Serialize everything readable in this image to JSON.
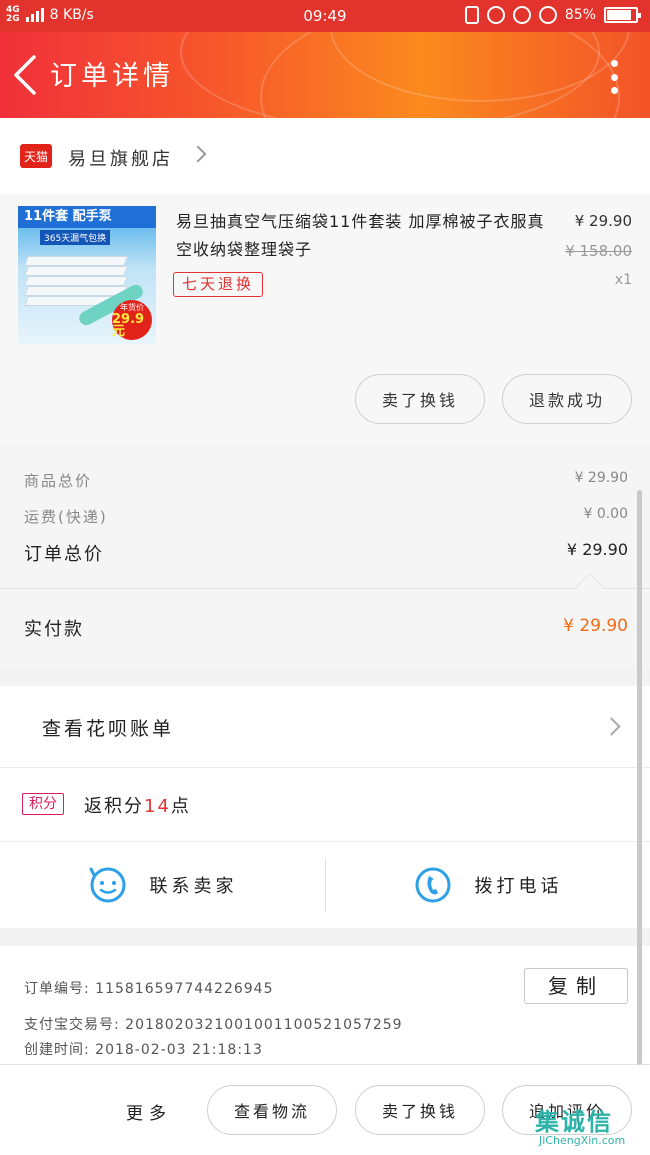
{
  "statusbar": {
    "net_top": "4G",
    "net_bottom": "2G",
    "speed": "8 KB/s",
    "time": "09:49",
    "battery": "85%",
    "battery_level": 0.85
  },
  "header": {
    "title": "订单详情"
  },
  "store": {
    "platform_badge": "天猫",
    "name": "易旦旗舰店"
  },
  "product": {
    "thumb_ribbon": "11件套 配手泵",
    "thumb_sub": "365天漏气包换",
    "thumb_badge_label": "年货价",
    "thumb_badge_price": "29.9元",
    "title": "易旦抽真空气压缩袋11件套装 加厚棉被子衣服真空收纳袋整理袋子",
    "tag": "七天退换",
    "price": "¥ 29.90",
    "original_price": "¥ 158.00",
    "quantity": "x1",
    "actions": [
      "卖了换钱",
      "退款成功"
    ]
  },
  "summary": {
    "rows": [
      {
        "label": "商品总价",
        "value": "¥ 29.90"
      },
      {
        "label": "运费(快递)",
        "value": "¥ 0.00"
      },
      {
        "label": "订单总价",
        "value": "¥ 29.90"
      }
    ],
    "paid_label": "实付款",
    "paid_value": "¥ 29.90"
  },
  "huabei": {
    "label": "查看花呗账单"
  },
  "points": {
    "tag": "积分",
    "prefix": "返积分",
    "number": "14",
    "suffix": "点"
  },
  "contact": {
    "seller_label": "联系卖家",
    "phone_label": "拨打电话"
  },
  "info": {
    "order_no": "订单编号:  1158165977442269​45",
    "alipay_no": "支付宝交易号:  2018020321001001100521057259",
    "created": "创建时间:  2018-02-03  21:18:13",
    "copy_label": "复制"
  },
  "bottom": {
    "more_label": "更多",
    "buttons": [
      "查看物流",
      "卖了换钱",
      "追加评价"
    ]
  },
  "watermark": {
    "cn": "集诚信",
    "en": "JiChengXin.com"
  },
  "colors": {
    "accent": "#f36b14",
    "header_red": "#f0303a",
    "header_orange": "#fb8a1e",
    "tag_red": "#e23434",
    "contact_blue": "#2da0e8"
  }
}
